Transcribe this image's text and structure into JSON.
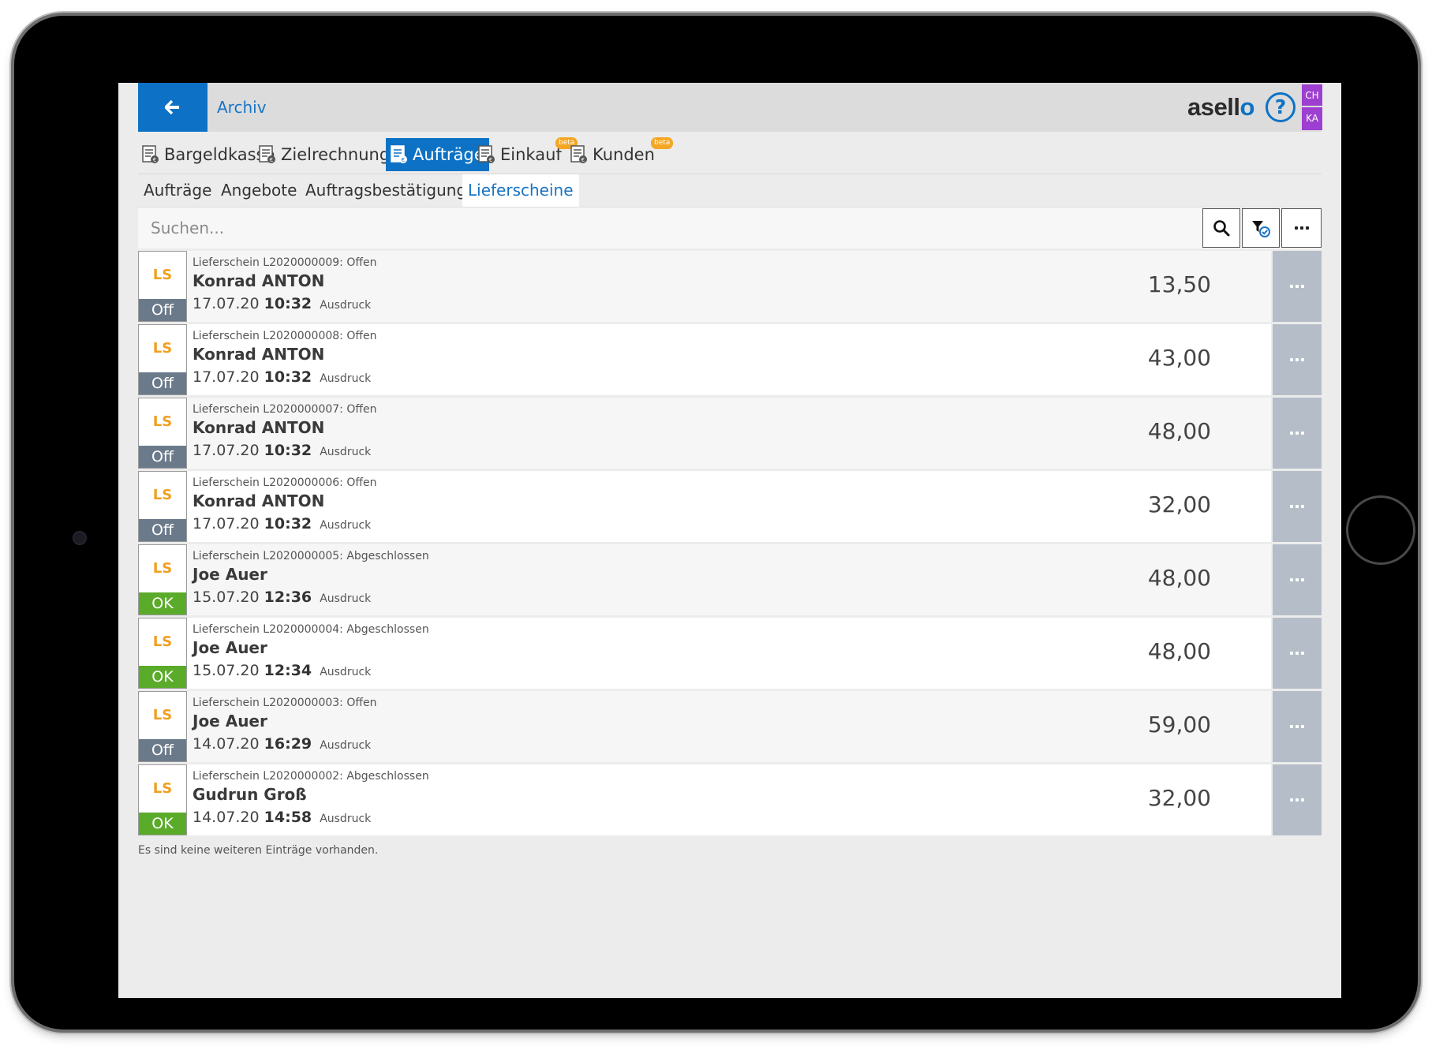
{
  "header": {
    "back_icon": "arrow-left-icon",
    "title": "Archiv",
    "brand_prefix": "asell",
    "brand_o": "o",
    "help_glyph": "?",
    "user_initials_top": "CH",
    "user_initials_bottom": "KA",
    "user_badge_color": "#9d3fd0",
    "accent_color": "#0d72c5"
  },
  "main_tabs": [
    {
      "label": "Bargeldkasse",
      "active": false
    },
    {
      "label": "Zielrechnungen",
      "active": false
    },
    {
      "label": "Aufträge",
      "active": true
    },
    {
      "label": "Einkauf",
      "active": false,
      "badge": "beta"
    },
    {
      "label": "Kunden",
      "active": false,
      "badge": "beta"
    }
  ],
  "sub_tabs": [
    {
      "label": "Aufträge",
      "active": false
    },
    {
      "label": "Angebote",
      "active": false
    },
    {
      "label": "Auftragsbestätigung",
      "active": false
    },
    {
      "label": "Lieferscheine",
      "active": true
    }
  ],
  "search": {
    "placeholder": "Suchen...",
    "value": ""
  },
  "rows": [
    {
      "type": "LS",
      "status": "Off",
      "status_kind": "off",
      "doc_line": "Lieferschein L2020000009: Offen",
      "customer": "Konrad ANTON",
      "date": "17.07.20",
      "time": "10:32",
      "mode": "Ausdruck",
      "amount": "13,50"
    },
    {
      "type": "LS",
      "status": "Off",
      "status_kind": "off",
      "doc_line": "Lieferschein L2020000008: Offen",
      "customer": "Konrad ANTON",
      "date": "17.07.20",
      "time": "10:32",
      "mode": "Ausdruck",
      "amount": "43,00"
    },
    {
      "type": "LS",
      "status": "Off",
      "status_kind": "off",
      "doc_line": "Lieferschein L2020000007: Offen",
      "customer": "Konrad ANTON",
      "date": "17.07.20",
      "time": "10:32",
      "mode": "Ausdruck",
      "amount": "48,00"
    },
    {
      "type": "LS",
      "status": "Off",
      "status_kind": "off",
      "doc_line": "Lieferschein L2020000006: Offen",
      "customer": "Konrad ANTON",
      "date": "17.07.20",
      "time": "10:32",
      "mode": "Ausdruck",
      "amount": "32,00"
    },
    {
      "type": "LS",
      "status": "OK",
      "status_kind": "ok",
      "doc_line": "Lieferschein L2020000005: Abgeschlossen",
      "customer": "Joe Auer",
      "date": "15.07.20",
      "time": "12:36",
      "mode": "Ausdruck",
      "amount": "48,00"
    },
    {
      "type": "LS",
      "status": "OK",
      "status_kind": "ok",
      "doc_line": "Lieferschein L2020000004: Abgeschlossen",
      "customer": "Joe Auer",
      "date": "15.07.20",
      "time": "12:34",
      "mode": "Ausdruck",
      "amount": "48,00"
    },
    {
      "type": "LS",
      "status": "Off",
      "status_kind": "off",
      "doc_line": "Lieferschein L2020000003: Offen",
      "customer": "Joe Auer",
      "date": "14.07.20",
      "time": "16:29",
      "mode": "Ausdruck",
      "amount": "59,00"
    },
    {
      "type": "LS",
      "status": "OK",
      "status_kind": "ok",
      "doc_line": "Lieferschein L2020000002: Abgeschlossen",
      "customer": "Gudrun Groß",
      "date": "14.07.20",
      "time": "14:58",
      "mode": "Ausdruck",
      "amount": "32,00"
    }
  ],
  "footer_note": "Es sind keine weiteren Einträge vorhanden.",
  "colors": {
    "type_code": "#f0a020",
    "status_off": "#6b7a8a",
    "status_ok": "#5bab2a",
    "beta_badge": "#f5a623"
  }
}
